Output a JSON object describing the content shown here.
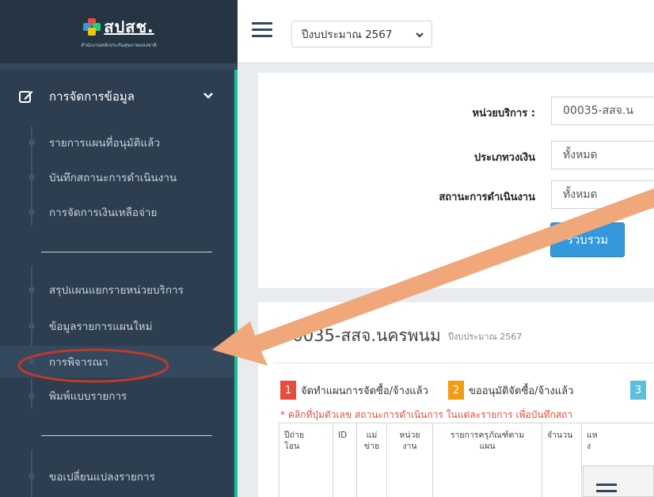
{
  "logo": {
    "name": "สปสช.",
    "subtitle": "สำนักงานหลักประกันสุขภาพแห่งชาติ"
  },
  "topbar": {
    "year_select": "ปีงบประมาณ 2567"
  },
  "sidebar": {
    "group_label": "การจัดการข้อมูล",
    "items": [
      "รายการแผนที่อนุมัติแล้ว",
      "บันทึกสถานะการดำเนินงาน",
      "การจัดการเงินเหลือจ่าย",
      "สรุปแผนแยกรายหน่วยบริการ",
      "ข้อมูลรายการแผนใหม่",
      "การพิจารณา",
      "พิมพ์แบบรายการ",
      "ขอเปลี่ยนแปลงรายการ"
    ]
  },
  "filters": {
    "unit_label": "หน่วยบริการ :",
    "unit_value": "00035-สสจ.น",
    "money_label": "ประเภทวงเงิน",
    "money_value": "ทั้งหมด",
    "status_label": "สถานะการดำเนินงาน",
    "status_value": "ทั้งหมด",
    "collect_button": "รวบรวม"
  },
  "results": {
    "title": "00035-สสจ.นครพนม",
    "year": "ปีงบประมาณ 2567",
    "legend": [
      {
        "num": "1",
        "text": "จัดทำแผนการจัดซื้อ/จ้างแล้ว",
        "color": "#e74c3c"
      },
      {
        "num": "2",
        "text": "ขออนุมัติจัดซื้อ/จ้างแล้ว",
        "color": "#f39c12"
      },
      {
        "num": "3",
        "text": "",
        "color": "#5bc0de"
      }
    ],
    "note": "* คลิกที่ปุ่มตัวเลข สถานะการดำเนินการ ในแต่ละรายการ เพื่อบันทึกสถา",
    "headers": [
      "ปีถ่าย\nโอน",
      "ID",
      "แม่\nข่าย",
      "หน่วย\nงาน",
      "รายการครุภัณฑ์ตาม\nแผน",
      "จำนวน",
      "แห\nง"
    ]
  },
  "colors": {
    "sidebar": "#2c3e50",
    "accent": "#1abc9c",
    "arrow": "#f0a77a",
    "highlight": "#c0392b",
    "button": "#3498db"
  }
}
